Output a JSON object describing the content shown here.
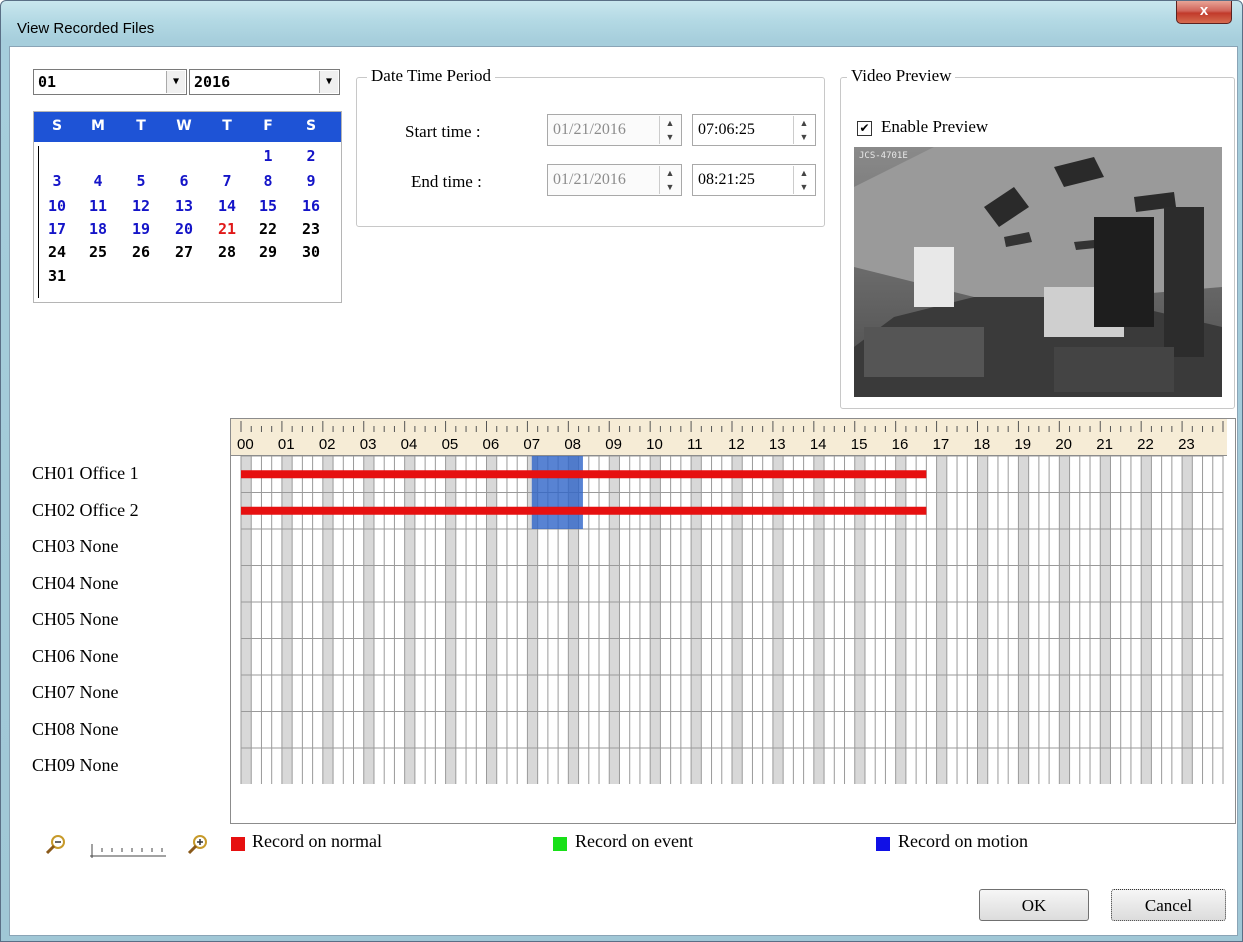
{
  "window": {
    "title": "View Recorded Files",
    "close_label": "x"
  },
  "calendar": {
    "month": "01",
    "year": "2016",
    "weekdays": [
      "S",
      "M",
      "T",
      "W",
      "T",
      "F",
      "S"
    ],
    "days": [
      {
        "d": "1",
        "col": 5,
        "row": 0,
        "color": "#1414c8"
      },
      {
        "d": "2",
        "col": 6,
        "row": 0,
        "color": "#1414c8"
      },
      {
        "d": "3",
        "col": 0,
        "row": 1,
        "color": "#1414c8"
      },
      {
        "d": "4",
        "col": 1,
        "row": 1,
        "color": "#1414c8"
      },
      {
        "d": "5",
        "col": 2,
        "row": 1,
        "color": "#1414c8"
      },
      {
        "d": "6",
        "col": 3,
        "row": 1,
        "color": "#1414c8"
      },
      {
        "d": "7",
        "col": 4,
        "row": 1,
        "color": "#1414c8"
      },
      {
        "d": "8",
        "col": 5,
        "row": 1,
        "color": "#1414c8"
      },
      {
        "d": "9",
        "col": 6,
        "row": 1,
        "color": "#1414c8"
      },
      {
        "d": "10",
        "col": 0,
        "row": 2,
        "color": "#1414c8"
      },
      {
        "d": "11",
        "col": 1,
        "row": 2,
        "color": "#1414c8"
      },
      {
        "d": "12",
        "col": 2,
        "row": 2,
        "color": "#1414c8"
      },
      {
        "d": "13",
        "col": 3,
        "row": 2,
        "color": "#1414c8"
      },
      {
        "d": "14",
        "col": 4,
        "row": 2,
        "color": "#1414c8"
      },
      {
        "d": "15",
        "col": 5,
        "row": 2,
        "color": "#1414c8"
      },
      {
        "d": "16",
        "col": 6,
        "row": 2,
        "color": "#1414c8"
      },
      {
        "d": "17",
        "col": 0,
        "row": 3,
        "color": "#1414c8"
      },
      {
        "d": "18",
        "col": 1,
        "row": 3,
        "color": "#1414c8"
      },
      {
        "d": "19",
        "col": 2,
        "row": 3,
        "color": "#1414c8"
      },
      {
        "d": "20",
        "col": 3,
        "row": 3,
        "color": "#1414c8"
      },
      {
        "d": "21",
        "col": 4,
        "row": 3,
        "color": "#e01818"
      },
      {
        "d": "22",
        "col": 5,
        "row": 3,
        "color": "#000000"
      },
      {
        "d": "23",
        "col": 6,
        "row": 3,
        "color": "#000000"
      },
      {
        "d": "24",
        "col": 0,
        "row": 4,
        "color": "#000000"
      },
      {
        "d": "25",
        "col": 1,
        "row": 4,
        "color": "#000000"
      },
      {
        "d": "26",
        "col": 2,
        "row": 4,
        "color": "#000000"
      },
      {
        "d": "27",
        "col": 3,
        "row": 4,
        "color": "#000000"
      },
      {
        "d": "28",
        "col": 4,
        "row": 4,
        "color": "#000000"
      },
      {
        "d": "29",
        "col": 5,
        "row": 4,
        "color": "#000000"
      },
      {
        "d": "30",
        "col": 6,
        "row": 4,
        "color": "#000000"
      },
      {
        "d": "31",
        "col": 0,
        "row": 5,
        "color": "#000000"
      }
    ]
  },
  "period": {
    "label": "Date Time Period",
    "start_label": "Start time :",
    "start_date": "01/21/2016",
    "start_time": "07:06:25",
    "end_label": "End time :",
    "end_date": "01/21/2016",
    "end_time": "08:21:25"
  },
  "preview": {
    "label": "Video Preview",
    "enable_label": "Enable Preview",
    "enabled": true,
    "overlay_text": "JCS-4701E"
  },
  "timeline": {
    "hours": [
      "00",
      "01",
      "02",
      "03",
      "04",
      "05",
      "06",
      "07",
      "08",
      "09",
      "10",
      "11",
      "12",
      "13",
      "14",
      "15",
      "16",
      "17",
      "18",
      "19",
      "20",
      "21",
      "22",
      "23"
    ],
    "channels": [
      {
        "name": "CH01 Office 1",
        "normal_end_hour": 16.75
      },
      {
        "name": "CH02 Office 2",
        "normal_end_hour": 16.75
      },
      {
        "name": "CH03 None"
      },
      {
        "name": "CH04 None"
      },
      {
        "name": "CH05 None"
      },
      {
        "name": "CH06 None"
      },
      {
        "name": "CH07 None"
      },
      {
        "name": "CH08 None"
      },
      {
        "name": "CH09 None"
      }
    ],
    "selection": {
      "start": "07:06:25",
      "end": "08:21:25"
    }
  },
  "legend": [
    {
      "label": "Record on normal",
      "color": "#e61010"
    },
    {
      "label": "Record on event",
      "color": "#18e018"
    },
    {
      "label": "Record on motion",
      "color": "#1010e6"
    }
  ],
  "buttons": {
    "ok": "OK",
    "cancel": "Cancel"
  }
}
